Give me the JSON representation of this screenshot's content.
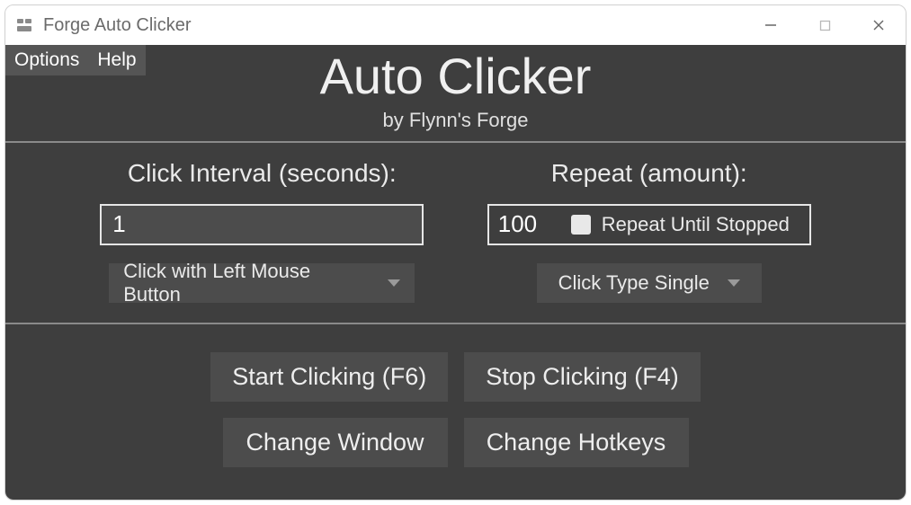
{
  "window": {
    "title": "Forge Auto Clicker"
  },
  "menubar": {
    "options": "Options",
    "help": "Help"
  },
  "header": {
    "title": "Auto Clicker",
    "subtitle": "by Flynn's Forge"
  },
  "interval": {
    "label": "Click Interval (seconds):",
    "value": "1",
    "mouse_dropdown": "Click with Left Mouse Button"
  },
  "repeat": {
    "label": "Repeat (amount):",
    "value": "100",
    "until_stopped_label": "Repeat Until Stopped",
    "until_stopped_checked": false,
    "type_dropdown": "Click Type Single"
  },
  "actions": {
    "start": "Start Clicking (F6)",
    "stop": "Stop Clicking (F4)",
    "change_window": "Change Window",
    "change_hotkeys": "Change Hotkeys"
  }
}
